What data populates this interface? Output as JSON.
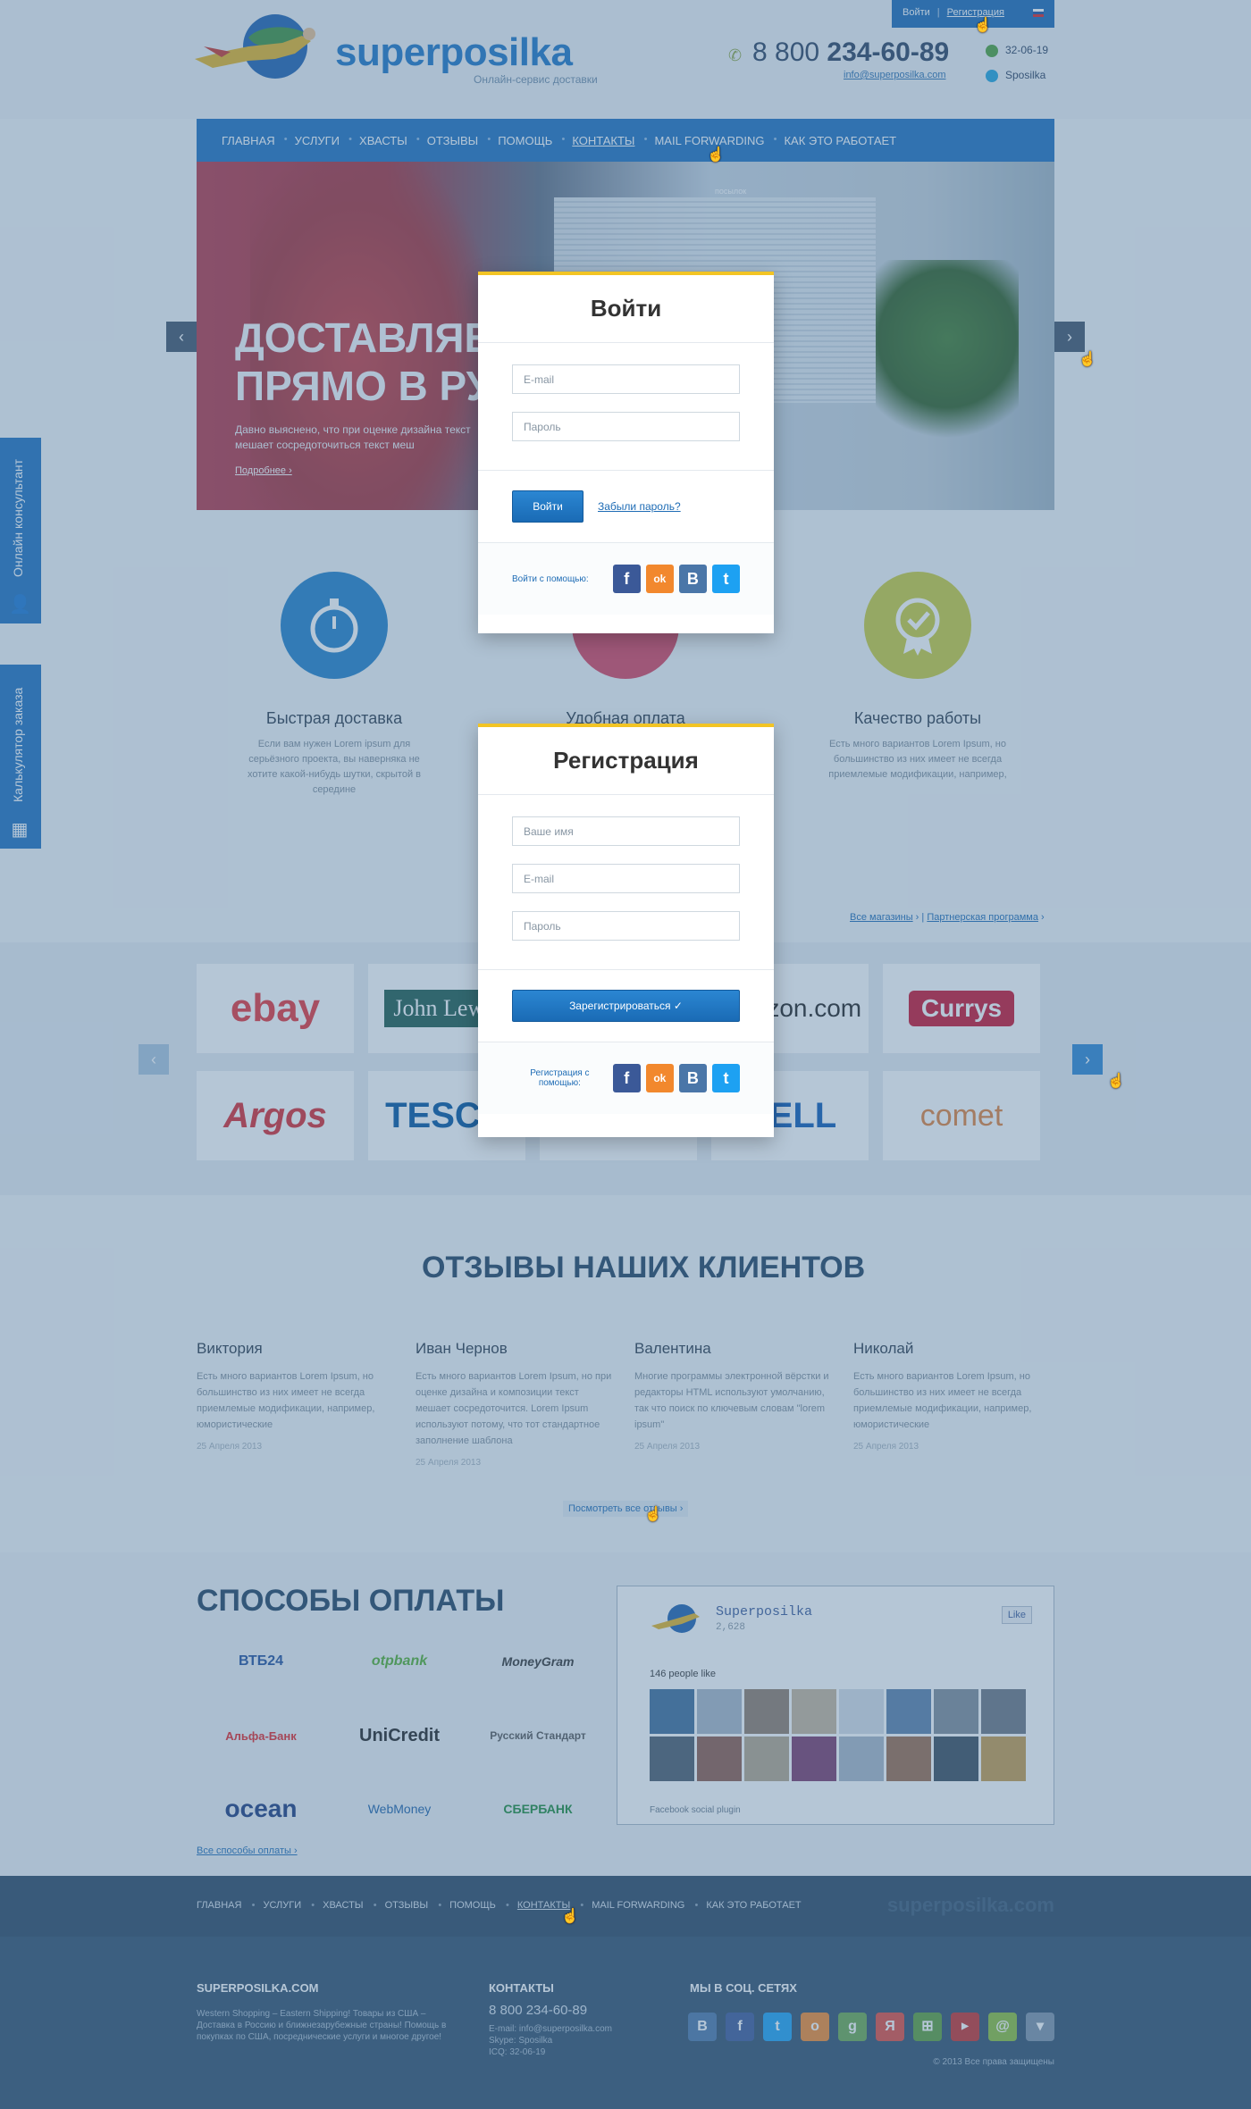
{
  "header": {
    "logo_text": "superposilka",
    "logo_sub": "Онлайн-сервис доставки",
    "phone_prefix": "8 800",
    "phone_main": "234-60-89",
    "email": "info@superposilka.com",
    "icq": "32-06-19",
    "skype": "Sposilka",
    "login_link": "Войти",
    "register_link": "Регистрация"
  },
  "nav": [
    "Главная",
    "Услуги",
    "Хвасты",
    "Отзывы",
    "Помощь",
    "Контакты",
    "Mail Forwarding",
    "Как это работает"
  ],
  "hero": {
    "title": "Доставляем\nпрямо в Ру",
    "desc": "Давно выяснено, что при оценке дизайна текст мешает сосредоточиться текст меш",
    "more": "Подробнее ›",
    "prev": "‹",
    "next": "›",
    "watermark": "посылок"
  },
  "side_tabs": {
    "consultant": "Онлайн консультант",
    "calculator": "Калькулятор заказа"
  },
  "features": [
    {
      "title": "Быстрая доставка",
      "text": "Если вам нужен Lorem ipsum для серьёзного проекта, вы наверняка не хотите какой-нибудь шутки, скрытой в середине"
    },
    {
      "title": "Удобная оплата",
      "text": ""
    },
    {
      "title": "Качество работы",
      "text": "Есть много вариантов Lorem Ipsum, но большинство из них имеет не всегда приемлемые модификации, например,"
    }
  ],
  "shop_links": {
    "all_shops": "Все магазины",
    "partner": "Партнерская программа"
  },
  "shops": [
    "ebay",
    "John Lewis",
    "",
    "amazon.com",
    "Currys",
    "Argos",
    "TESCO",
    "",
    "DELL",
    "comet"
  ],
  "login_modal": {
    "title": "Войти",
    "email_placeholder": "E-mail",
    "password_placeholder": "Пароль",
    "submit": "Войти",
    "forgot": "Забыли пароль?",
    "social_label": "Войти с помощью:"
  },
  "register_modal": {
    "title": "Регистрация",
    "name_placeholder": "Ваше имя",
    "email_placeholder": "E-mail",
    "password_placeholder": "Пароль",
    "submit": "Зарегистрироваться ✓",
    "social_label": "Регистрация с помощью:"
  },
  "social_icons": [
    "f",
    "ok",
    "B",
    "t"
  ],
  "reviews_title": "Отзывы наших клиентов",
  "reviews": [
    {
      "name": "Виктория",
      "text": "Есть много вариантов Lorem Ipsum, но большинство из них имеет не всегда приемлемые модификации, например, юмористические",
      "date": "25 Апреля 2013"
    },
    {
      "name": "Иван Чернов",
      "text": "Есть много вариантов Lorem Ipsum, но при оценке дизайна и композиции текст мешает сосредоточится. Lorem Ipsum используют потому, что тот стандартное заполнение шаблона",
      "date": "25 Апреля 2013"
    },
    {
      "name": "Валентина",
      "text": "Многие программы электронной вёрстки и редакторы HTML используют умолчанию, так что поиск по ключевым словам \"lorem ipsum\"",
      "date": "25 Апреля 2013"
    },
    {
      "name": "Николай",
      "text": "Есть много вариантов Lorem Ipsum, но большинство из них имеет не всегда приемлемые модификации, например, юмористические",
      "date": "25 Апреля 2013"
    }
  ],
  "all_reviews": "Посмотреть все отзывы ›",
  "payments_title": "Способы оплаты",
  "payments": [
    "ВТБ24",
    "otpbank",
    "MoneyGram",
    "Альфа-Банк",
    "UniCredit",
    "Русский Стандарт",
    "ocean",
    "WebMoney",
    "СБЕРБАНК"
  ],
  "all_payments": "Все способы оплаты ›",
  "fb": {
    "name": "Superposilka",
    "count": "2,628",
    "like": "Like",
    "people": "146 people like",
    "plugin": "Facebook social plugin"
  },
  "footer_nav": [
    "Главная",
    "Услуги",
    "Хвасты",
    "Отзывы",
    "Помощь",
    "Контакты",
    "Mail Forwarding",
    "Как это работает"
  ],
  "footer_logo": "superposilka.com",
  "footer": {
    "col1_title": "SUPERPOSILKA.COM",
    "col1_text": "Western Shopping – Eastern Shipping! Товары из США – Доставка в Россию и ближнезарубежные страны! Помощь в покупках по США, посреднические услуги и многое другое!",
    "col2_title": "КОНТАКТЫ",
    "col2_phone": "8 800 234-60-89",
    "col2_email": "E-mail: info@superposilka.com",
    "col2_skype": "Skype: Sposilka",
    "col2_icq": "ICQ: 32-06-19",
    "col3_title": "МЫ В СОЦ. СЕТЯХ",
    "copyright": "© 2013 Все права защищены"
  }
}
